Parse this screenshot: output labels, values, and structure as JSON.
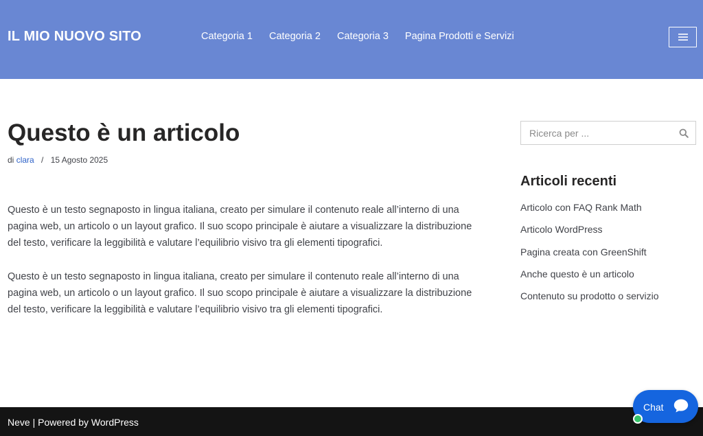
{
  "header": {
    "site_title": "IL MIO NUOVO SITO",
    "nav": [
      {
        "label": "Categoria 1"
      },
      {
        "label": "Categoria 2"
      },
      {
        "label": "Categoria 3"
      },
      {
        "label": "Pagina Prodotti e Servizi"
      }
    ],
    "menu_icon": "hamburger-icon",
    "background_color": "#6987d3"
  },
  "article": {
    "title": "Questo è un articolo",
    "meta_prefix": "di",
    "author": "clara",
    "meta_separator": "/",
    "date": "15 Agosto 2025",
    "paragraphs": [
      "Questo è un testo segnaposto in lingua italiana, creato per simulare il contenuto reale all’interno di una pagina web, un articolo o un layout grafico. Il suo scopo principale è aiutare a visualizzare la distribuzione del testo, verificare la leggibilità e valutare l’equilibrio visivo tra gli elementi tipografici.",
      "Questo è un testo segnaposto in lingua italiana, creato per simulare il contenuto reale all’interno di una pagina web, un articolo o un layout grafico. Il suo scopo principale è aiutare a visualizzare la distribuzione del testo, verificare la leggibilità e valutare l’equilibrio visivo tra gli elementi tipografici."
    ],
    "author_link_color": "#2e62c8"
  },
  "sidebar": {
    "search": {
      "placeholder": "Ricerca per ...",
      "value": "",
      "icon": "search-icon"
    },
    "recent_title": "Articoli recenti",
    "recent_posts": [
      {
        "label": "Articolo con FAQ Rank Math"
      },
      {
        "label": "Articolo WordPress"
      },
      {
        "label": "Pagina creata con GreenShift"
      },
      {
        "label": "Anche questo è un articolo"
      },
      {
        "label": "Contenuto su prodotto o servizio"
      }
    ]
  },
  "footer": {
    "theme": "Neve",
    "separator": " | ",
    "powered": "Powered by WordPress",
    "background_color": "#141414"
  },
  "chat": {
    "label": "Chat",
    "icon": "chat-bubble-icon",
    "status_icon": "online-status-icon",
    "color": "#1565df"
  }
}
